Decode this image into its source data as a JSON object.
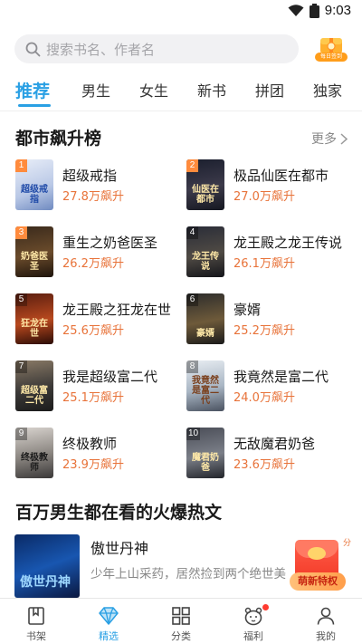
{
  "status_bar": {
    "time": "9:03",
    "icons": [
      "wifi-icon",
      "battery-icon"
    ]
  },
  "search": {
    "placeholder": "搜索书名、作者名",
    "icon": "search-icon"
  },
  "daily_sign": {
    "label": "每日签到",
    "icon": "gift-box-icon"
  },
  "tabs": [
    {
      "label": "推荐",
      "active": true
    },
    {
      "label": "男生"
    },
    {
      "label": "女生"
    },
    {
      "label": "新书"
    },
    {
      "label": "拼团"
    },
    {
      "label": "独家"
    }
  ],
  "ranking": {
    "title": "都市飙升榜",
    "more_label": "更多",
    "items": [
      {
        "rank": "1",
        "name": "超级戒指",
        "heat": "27.8万飙升",
        "cover_text": "超级戒指"
      },
      {
        "rank": "2",
        "name": "极品仙医在都市",
        "heat": "27.0万飙升",
        "cover_text": "仙医在都市"
      },
      {
        "rank": "3",
        "name": "重生之奶爸医圣",
        "heat": "26.2万飙升",
        "cover_text": "奶爸医圣"
      },
      {
        "rank": "4",
        "name": "龙王殿之龙王传说",
        "heat": "26.1万飙升",
        "cover_text": "龙王传说"
      },
      {
        "rank": "5",
        "name": "龙王殿之狂龙在世",
        "heat": "25.6万飙升",
        "cover_text": "狂龙在世"
      },
      {
        "rank": "6",
        "name": "豪婿",
        "heat": "25.2万飙升",
        "cover_text": "豪婿"
      },
      {
        "rank": "7",
        "name": "我是超级富二代",
        "heat": "25.1万飙升",
        "cover_text": "超级富二代"
      },
      {
        "rank": "8",
        "name": "我竟然是富二代",
        "heat": "24.0万飙升",
        "cover_text": "我竟然是富二代"
      },
      {
        "rank": "9",
        "name": "终极教师",
        "heat": "23.9万飙升",
        "cover_text": "终极教师"
      },
      {
        "rank": "10",
        "name": "无敌魔君奶爸",
        "heat": "23.6万飙升",
        "cover_text": "魔君奶爸"
      }
    ]
  },
  "hot_section": {
    "title": "百万男生都在看的火爆热文",
    "book": {
      "title": "傲世丹神",
      "desc": "少年上山采药，居然捡到两个绝世美",
      "cover_text": "傲世丹神"
    }
  },
  "promo": {
    "label": "萌新特权",
    "corner": "分"
  },
  "bottom_nav": [
    {
      "label": "书架",
      "icon": "bookshelf-icon"
    },
    {
      "label": "精选",
      "icon": "diamond-icon",
      "active": true
    },
    {
      "label": "分类",
      "icon": "grid-icon"
    },
    {
      "label": "福利",
      "icon": "gift-bear-icon",
      "badge": true
    },
    {
      "label": "我的",
      "icon": "profile-icon"
    }
  ]
}
